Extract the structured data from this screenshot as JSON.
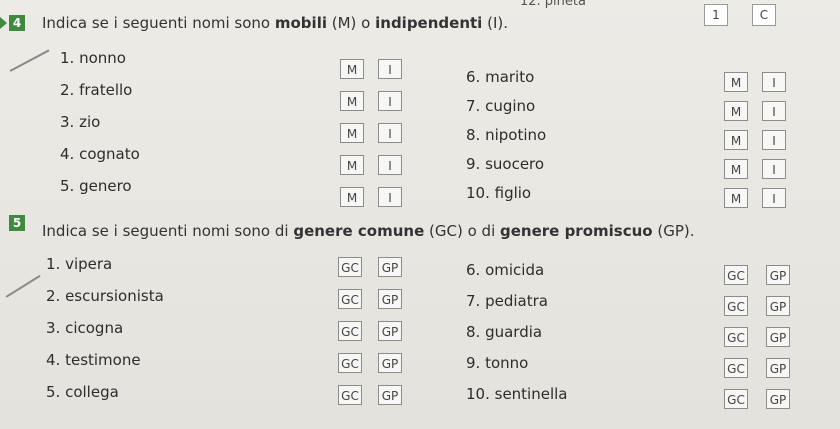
{
  "header": {
    "fragment": "12. pineta",
    "corner_labels": [
      "1",
      "C"
    ]
  },
  "exercise4": {
    "number": "4",
    "instruction_parts": [
      "Indica se i seguenti nomi sono ",
      "mobili",
      " (M) o ",
      "indipendenti",
      " (I)."
    ],
    "options": [
      "M",
      "I"
    ],
    "left": [
      "1. nonno",
      "2. fratello",
      "3. zio",
      "4. cognato",
      "5. genero"
    ],
    "right": [
      "6. marito",
      "7. cugino",
      "8. nipotino",
      "9. suocero",
      "10. figlio"
    ]
  },
  "exercise5": {
    "number": "5",
    "instruction_parts": [
      "Indica se i seguenti nomi sono di ",
      "genere comune",
      " (GC) o di ",
      "genere promiscuo",
      " (GP)."
    ],
    "options": [
      "GC",
      "GP"
    ],
    "left": [
      "1. vipera",
      "2. escursionista",
      "3. cicogna",
      "4. testimone",
      "5. collega"
    ],
    "right": [
      "6. omicida",
      "7. pediatra",
      "8. guardia",
      "9. tonno",
      "10. sentinella"
    ]
  },
  "colors": {
    "badge": "#3e8a3e",
    "text": "#2d2d2d",
    "paper": "#e9e6df"
  }
}
